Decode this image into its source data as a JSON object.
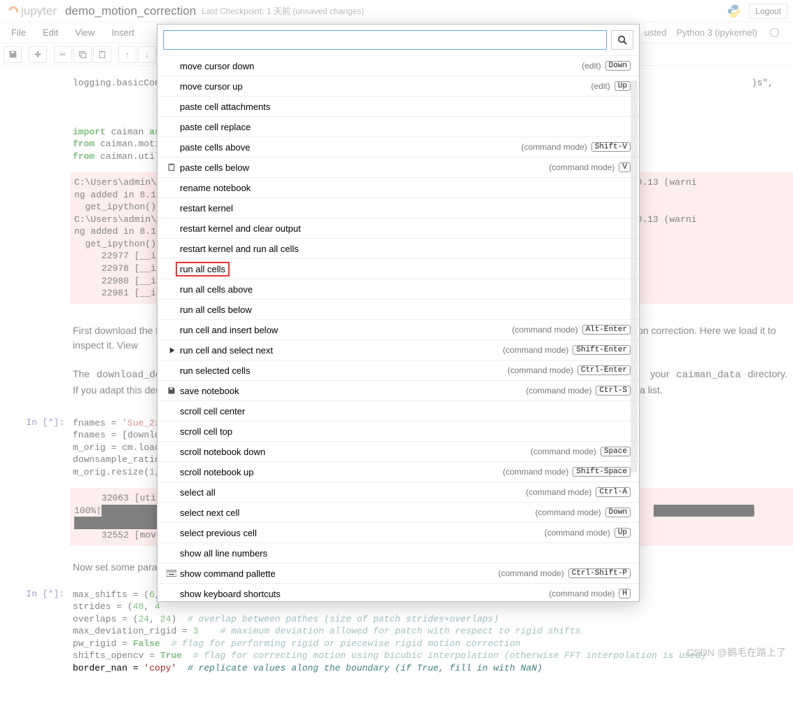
{
  "header": {
    "logo_text": "jupyter",
    "notebook_name": "demo_motion_correction",
    "checkpoint": "Last Checkpoint: 1 天前   (unsaved changes)",
    "logout": "Logout"
  },
  "menubar": {
    "items": [
      "File",
      "Edit",
      "View",
      "Insert"
    ],
    "trusted_visible_fragment": "usted",
    "kernel": "Python 3 (ipykernel)"
  },
  "toolbar": {
    "save_title": "Save and Checkpoint",
    "add_title": "insert cell below",
    "cut_title": "cut selected cells",
    "copy_title": "copy selected cells",
    "paste_title": "paste cells below",
    "up_title": "move cell up",
    "down_title": "move cell down"
  },
  "palette": {
    "search_placeholder": "",
    "edit_mode_label": "(edit)",
    "command_mode_label": "(command mode)",
    "items": [
      {
        "label": "move cursor down",
        "mode": "edit",
        "shortcut": "Down",
        "icon": ""
      },
      {
        "label": "move cursor up",
        "mode": "edit",
        "shortcut": "Up",
        "icon": ""
      },
      {
        "label": "paste cell attachments",
        "mode": "",
        "shortcut": "",
        "icon": ""
      },
      {
        "label": "paste cell replace",
        "mode": "",
        "shortcut": "",
        "icon": ""
      },
      {
        "label": "paste cells above",
        "mode": "command",
        "shortcut": "Shift-V",
        "icon": ""
      },
      {
        "label": "paste cells below",
        "mode": "command",
        "shortcut": "V",
        "icon": "paste"
      },
      {
        "label": "rename notebook",
        "mode": "",
        "shortcut": "",
        "icon": ""
      },
      {
        "label": "restart kernel",
        "mode": "",
        "shortcut": "",
        "icon": ""
      },
      {
        "label": "restart kernel and clear output",
        "mode": "",
        "shortcut": "",
        "icon": ""
      },
      {
        "label": "restart kernel and run all cells",
        "mode": "",
        "shortcut": "",
        "icon": ""
      },
      {
        "label": "run all cells",
        "mode": "",
        "shortcut": "",
        "icon": "",
        "highlight": true
      },
      {
        "label": "run all cells above",
        "mode": "",
        "shortcut": "",
        "icon": ""
      },
      {
        "label": "run all cells below",
        "mode": "",
        "shortcut": "",
        "icon": ""
      },
      {
        "label": "run cell and insert below",
        "mode": "command",
        "shortcut": "Alt-Enter",
        "icon": ""
      },
      {
        "label": "run cell and select next",
        "mode": "command",
        "shortcut": "Shift-Enter",
        "icon": "play"
      },
      {
        "label": "run selected cells",
        "mode": "command",
        "shortcut": "Ctrl-Enter",
        "icon": ""
      },
      {
        "label": "save notebook",
        "mode": "command",
        "shortcut": "Ctrl-S",
        "icon": "save"
      },
      {
        "label": "scroll cell center",
        "mode": "",
        "shortcut": "",
        "icon": ""
      },
      {
        "label": "scroll cell top",
        "mode": "",
        "shortcut": "",
        "icon": ""
      },
      {
        "label": "scroll notebook down",
        "mode": "command",
        "shortcut": "Space",
        "icon": ""
      },
      {
        "label": "scroll notebook up",
        "mode": "command",
        "shortcut": "Shift-Space",
        "icon": ""
      },
      {
        "label": "select all",
        "mode": "command",
        "shortcut": "Ctrl-A",
        "icon": ""
      },
      {
        "label": "select next cell",
        "mode": "command",
        "shortcut": "Down",
        "icon": ""
      },
      {
        "label": "select previous cell",
        "mode": "command",
        "shortcut": "Up",
        "icon": ""
      },
      {
        "label": "show all line numbers",
        "mode": "",
        "shortcut": "",
        "icon": ""
      },
      {
        "label": "show command pallette",
        "mode": "command",
        "shortcut": "Ctrl-Shift-P",
        "icon": "keyboard"
      },
      {
        "label": "show keyboard shortcuts",
        "mode": "command",
        "shortcut": "H",
        "icon": ""
      }
    ]
  },
  "cells": {
    "c0_line1": "logging.basicConfi",
    "c0_tail": ")s\",",
    "c1_import": "import",
    "c1_l1_rest": " caiman ",
    "c1_as": "as",
    "c1_from": "from",
    "c1_l2": " caiman.motio",
    "c1_l3": " caiman.utils",
    "stderr_block": "C:\\Users\\admin\\Ap                                                                        since IPython 0.13 (warni\nng added in 8.1),\n  get_ipython().m\nC:\\Users\\admin\\Ap                                                                        since IPython 0.13 (warni\nng added in 8.1),\n  get_ipython().m\n     22977 [__i\n     22978 [__i\n     22980 [__i\n     22981 [__i",
    "md1_a": "First download the f",
    "md1_b": "otion correction. Here we load it to inspect it. View",
    "md2_a": "The  ",
    "md2_code1": "download_demo",
    "md2_b": "your  ",
    "md2_code2": "caiman_data",
    "md2_c": "  directory. If you adapt this dem",
    "md2_d": "a list.",
    "prompt_in_star": "In  [*]:",
    "c2_l1_a": "fnames = ",
    "c2_l1_b": "'Sue_2x_",
    "c2_l2": "fnames = [downloa",
    "c2_l3": "m_orig = cm.load_",
    "c2_l4": "downsample_ratio ",
    "c2_l5_a": "m_orig.resize(",
    "c2_l5_b": "1",
    "out2_l1": "     32063 [uti",
    "out2_l2a": "100%|",
    "out2_l3": "     32552 [mov",
    "md3": "Now set some para",
    "c3_l1_a": "max_shifts = (",
    "c3_l1_b": "6",
    "c3_l2_a": "strides = (",
    "c3_l2_b": "48",
    "c3_l2_c": ", ",
    "c3_l2_d": "4",
    "c3_l3_a": "overlaps = (",
    "c3_l3_b": "24",
    "c3_l3_c": ", ",
    "c3_l3_d": "24",
    "c3_l3_e": ")  ",
    "c3_l3_cmt": "# overlap between pathes (size of patch strides+overlaps)",
    "c3_l4_a": "max_deviation_rigid = ",
    "c3_l4_b": "3",
    "c3_l4_c": "    ",
    "c3_l4_cmt": "# maximum deviation allowed for patch with respect to rigid shifts",
    "c3_l5_a": "pw_rigid = ",
    "c3_l5_b": "False",
    "c3_l5_c": "  ",
    "c3_l5_cmt": "# flag for performing rigid or piecewise rigid motion correction",
    "c3_l6_a": "shifts_opencv = ",
    "c3_l6_b": "True",
    "c3_l6_c": "  ",
    "c3_l6_cmt": "# flag for correcting motion using bicubic interpolation (otherwise FFT interpolation is used)",
    "c3_l7_a": "border_nan = ",
    "c3_l7_b": "'copy'",
    "c3_l7_c": "  ",
    "c3_l7_cmt": "# replicate values along the boundary (if True, fill in with NaN)"
  },
  "watermark": "CSDN @鹅毛在路上了"
}
